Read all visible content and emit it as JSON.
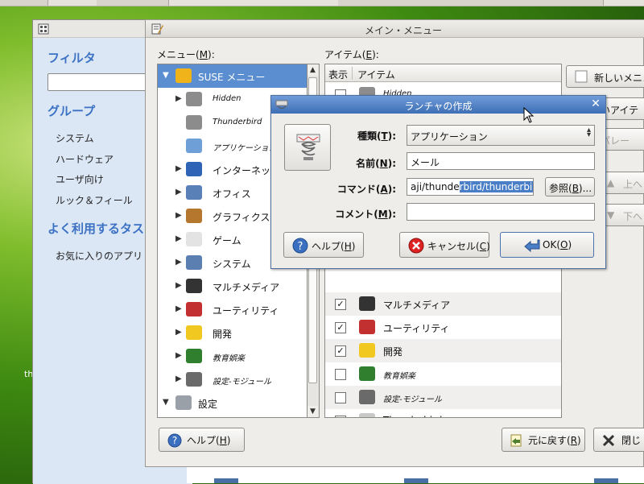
{
  "desktop": {
    "text": "th"
  },
  "control_center": {
    "filter_title": "フィルタ",
    "group_title": "グループ",
    "groups": [
      "システム",
      "ハードウェア",
      "ユーザ向け",
      "ルック＆フィール"
    ],
    "common_tasks_title": "よく利用するタス",
    "favorites": "お気に入りのアプリ"
  },
  "main_window": {
    "title": "メイン・メニュー",
    "menu_label": "メニュー(",
    "menu_key": "M",
    "menu_label_end": "):",
    "items_label": "アイテム(",
    "items_key": "E",
    "items_label_end": "):",
    "header_show": "表示",
    "header_item": "アイテム",
    "help_button": "ヘルプ(",
    "help_key": "H",
    "revert_button": "元に戻す(",
    "revert_key": "R",
    "close_button": "閉じ",
    "right_buttons": {
      "new_menu": "新しいメニュ",
      "new_item": "しいアイテ",
      "separator": "セパレー",
      "up": "上へ",
      "down": "下へ"
    }
  },
  "tree": [
    {
      "label": "SUSE メニュー",
      "arrow": "▼",
      "indent": 0,
      "selected": true,
      "italic": false,
      "icon": "suse-menu-icon"
    },
    {
      "label": "Hidden",
      "arrow": "▶",
      "indent": 1,
      "selected": false,
      "italic": true,
      "icon": "folder-icon"
    },
    {
      "label": "Thunderbird",
      "arrow": "",
      "indent": 1,
      "selected": false,
      "italic": true,
      "icon": "folder-icon"
    },
    {
      "label": "アプリケーション",
      "arrow": "",
      "indent": 1,
      "selected": false,
      "italic": true,
      "icon": "applications-icon"
    },
    {
      "label": "インターネット",
      "arrow": "▶",
      "indent": 1,
      "selected": false,
      "italic": false,
      "icon": "internet-icon"
    },
    {
      "label": "オフィス",
      "arrow": "▶",
      "indent": 1,
      "selected": false,
      "italic": false,
      "icon": "office-icon"
    },
    {
      "label": "グラフィクス",
      "arrow": "▶",
      "indent": 1,
      "selected": false,
      "italic": false,
      "icon": "graphics-icon"
    },
    {
      "label": "ゲーム",
      "arrow": "▶",
      "indent": 1,
      "selected": false,
      "italic": false,
      "icon": "games-icon"
    },
    {
      "label": "システム",
      "arrow": "▶",
      "indent": 1,
      "selected": false,
      "italic": false,
      "icon": "system-icon"
    },
    {
      "label": "マルチメディア",
      "arrow": "▶",
      "indent": 1,
      "selected": false,
      "italic": false,
      "icon": "multimedia-icon"
    },
    {
      "label": "ユーティリティ",
      "arrow": "▶",
      "indent": 1,
      "selected": false,
      "italic": false,
      "icon": "utilities-icon"
    },
    {
      "label": "開発",
      "arrow": "▶",
      "indent": 1,
      "selected": false,
      "italic": false,
      "icon": "development-icon"
    },
    {
      "label": "教育娯楽",
      "arrow": "▶",
      "indent": 1,
      "selected": false,
      "italic": true,
      "icon": "education-icon"
    },
    {
      "label": "設定-モジュール",
      "arrow": "▶",
      "indent": 1,
      "selected": false,
      "italic": true,
      "icon": "settings-module-icon"
    },
    {
      "label": "設定",
      "arrow": "▼",
      "indent": 0,
      "selected": false,
      "italic": false,
      "icon": "settings-icon"
    }
  ],
  "items": [
    {
      "label": "Hidden",
      "checked": false,
      "italic": true,
      "icon": "folder-icon"
    },
    {
      "label": "マルチメディア",
      "checked": true,
      "italic": false,
      "icon": "multimedia-icon"
    },
    {
      "label": "ユーティリティ",
      "checked": true,
      "italic": false,
      "icon": "utilities-icon"
    },
    {
      "label": "開発",
      "checked": true,
      "italic": false,
      "icon": "development-icon"
    },
    {
      "label": "教育娯楽",
      "checked": false,
      "italic": true,
      "icon": "education-icon"
    },
    {
      "label": "設定-モジュール",
      "checked": false,
      "italic": true,
      "icon": "settings-module-icon"
    },
    {
      "label": "Thunderbird",
      "checked": true,
      "italic": false,
      "icon": "thunderbird-icon"
    }
  ],
  "dialog": {
    "title": "ランチャの作成",
    "type_label": "種類(",
    "type_key": "T",
    "type_value": "アプリケーション",
    "name_label": "名前(",
    "name_key": "N",
    "name_value": "メール",
    "command_label": "コマンド(",
    "command_key": "A",
    "command_prefix": "aji/thunde",
    "command_selected": "rbird/thunderbird",
    "comment_label": "コメント(",
    "comment_key": "M",
    "comment_value": "",
    "browse_button": "参照(",
    "browse_key": "B",
    "browse_end": ")...",
    "help_button": "ヘルプ(",
    "help_key": "H",
    "cancel_button": "キャンセル(",
    "cancel_key": "C",
    "ok_button": "OK(",
    "ok_key": "O",
    "close_paren": ")",
    "label_end": "):"
  },
  "colors": {
    "selection": "#5b8ed1",
    "dialog_title": "#3e6fb5",
    "cc_title": "#3c72c4"
  }
}
